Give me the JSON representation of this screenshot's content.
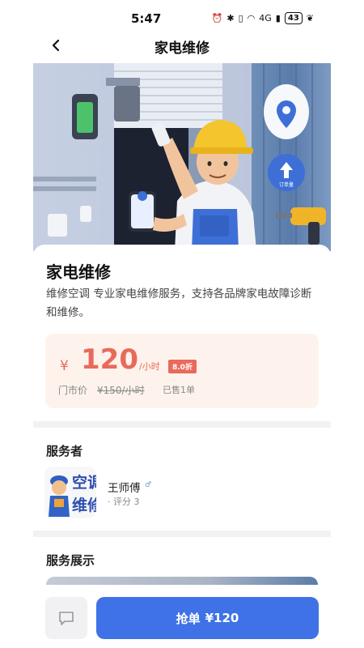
{
  "status_bar": {
    "time": "5:47",
    "network": "4G",
    "battery": "43"
  },
  "header": {
    "title": "家电维修"
  },
  "service": {
    "name": "家电维修",
    "description": "维修空调 专业家电维修服务，支持各品牌家电故障诊断和维修。",
    "price": {
      "currency": "¥",
      "amount": "120",
      "unit": "/小时",
      "discount": "8.0折",
      "market_label": "门市价",
      "market_price": "¥150/小时",
      "sold": "已售1单"
    }
  },
  "hero": {
    "badge_text": "订单量"
  },
  "provider": {
    "section_title": "服务者",
    "name": "王师傅",
    "gender": "♂",
    "rating": "· 评分 3",
    "avatar_text": "空调维修"
  },
  "showcase": {
    "section_title": "服务展示"
  },
  "bottom_bar": {
    "order_label": "抢单",
    "order_price": "¥120"
  },
  "colors": {
    "accent": "#3f72e6",
    "price": "#e96a5c",
    "price_bg": "#fdf3ec"
  }
}
